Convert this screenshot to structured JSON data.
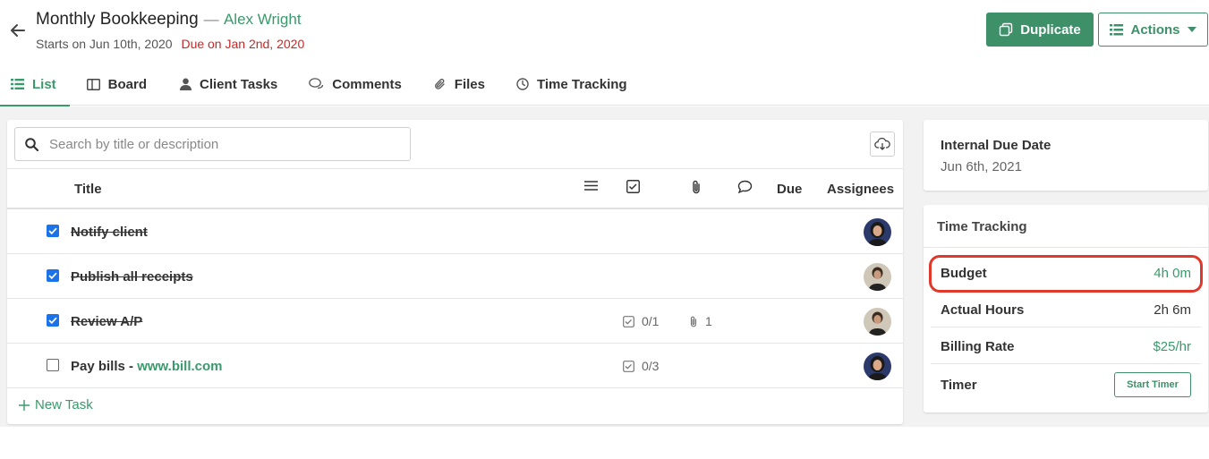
{
  "header": {
    "title": "Monthly Bookkeeping",
    "separator": "—",
    "client": "Alex Wright",
    "starts": "Starts on Jun 10th, 2020",
    "due": "Due on Jan 2nd, 2020",
    "duplicate_label": "Duplicate",
    "actions_label": "Actions",
    "brand_color": "#3e9069"
  },
  "tabs": [
    {
      "label": "List",
      "icon": "list-icon"
    },
    {
      "label": "Board",
      "icon": "board-icon"
    },
    {
      "label": "Client Tasks",
      "icon": "person-icon"
    },
    {
      "label": "Comments",
      "icon": "comments-icon"
    },
    {
      "label": "Files",
      "icon": "paperclip-icon"
    },
    {
      "label": "Time Tracking",
      "icon": "clock-icon"
    }
  ],
  "search": {
    "placeholder": "Search by title or description"
  },
  "table": {
    "headers": {
      "title": "Title",
      "due": "Due",
      "assignees": "Assignees"
    },
    "rows": [
      {
        "title": "Notify client",
        "done": true,
        "subtasks": "",
        "files": ""
      },
      {
        "title": "Publish all receipts",
        "done": true,
        "subtasks": "",
        "files": ""
      },
      {
        "title": "Review A/P",
        "done": true,
        "subtasks": "0/1",
        "files": "1"
      },
      {
        "title": "Pay bills - ",
        "link": "www.bill.com",
        "done": false,
        "subtasks": "0/3",
        "files": ""
      }
    ],
    "new_task": "New Task"
  },
  "sidebar": {
    "internal_due_label": "Internal Due Date",
    "internal_due_value": "Jun 6th, 2021",
    "time_tracking_title": "Time Tracking",
    "budget_label": "Budget",
    "budget_value": "4h 0m",
    "actual_label": "Actual Hours",
    "actual_value": "2h 6m",
    "rate_label": "Billing Rate",
    "rate_value": "$25/hr",
    "timer_label": "Timer",
    "start_timer": "Start Timer"
  }
}
